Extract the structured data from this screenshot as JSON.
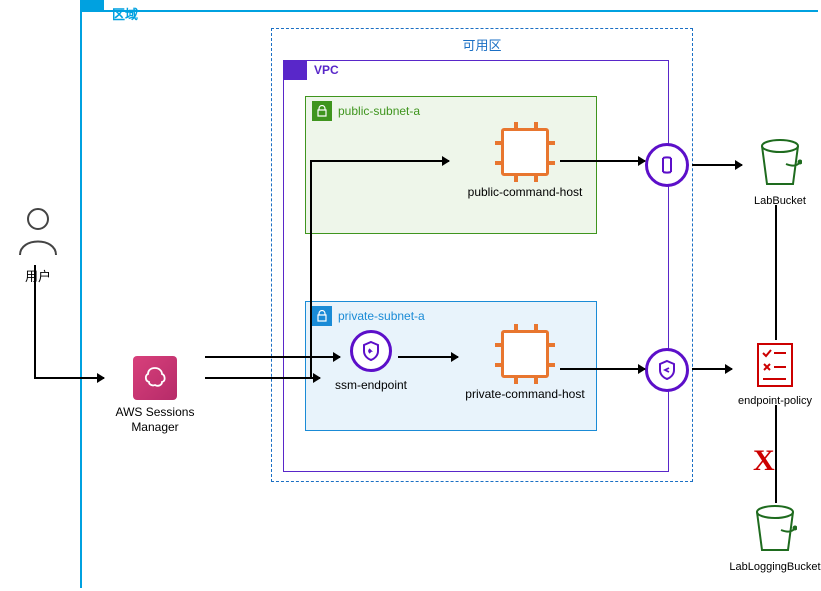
{
  "user": {
    "label": "用户"
  },
  "ssm": {
    "label": "AWS Sessions Manager"
  },
  "region": {
    "label": "区域"
  },
  "az": {
    "label": "可用区"
  },
  "vpc": {
    "label": "VPC"
  },
  "subnets": {
    "public": {
      "name": "public-subnet-a"
    },
    "private": {
      "name": "private-subnet-a"
    }
  },
  "hosts": {
    "public_cmd": "public-command-host",
    "private_cmd": "private-command-host"
  },
  "endpoints": {
    "ssm": "ssm-endpoint"
  },
  "policy": {
    "label": "endpoint-policy"
  },
  "buckets": {
    "lab": "LabBucket",
    "logging": "LabLoggingBucket"
  },
  "deny_marker": "X"
}
